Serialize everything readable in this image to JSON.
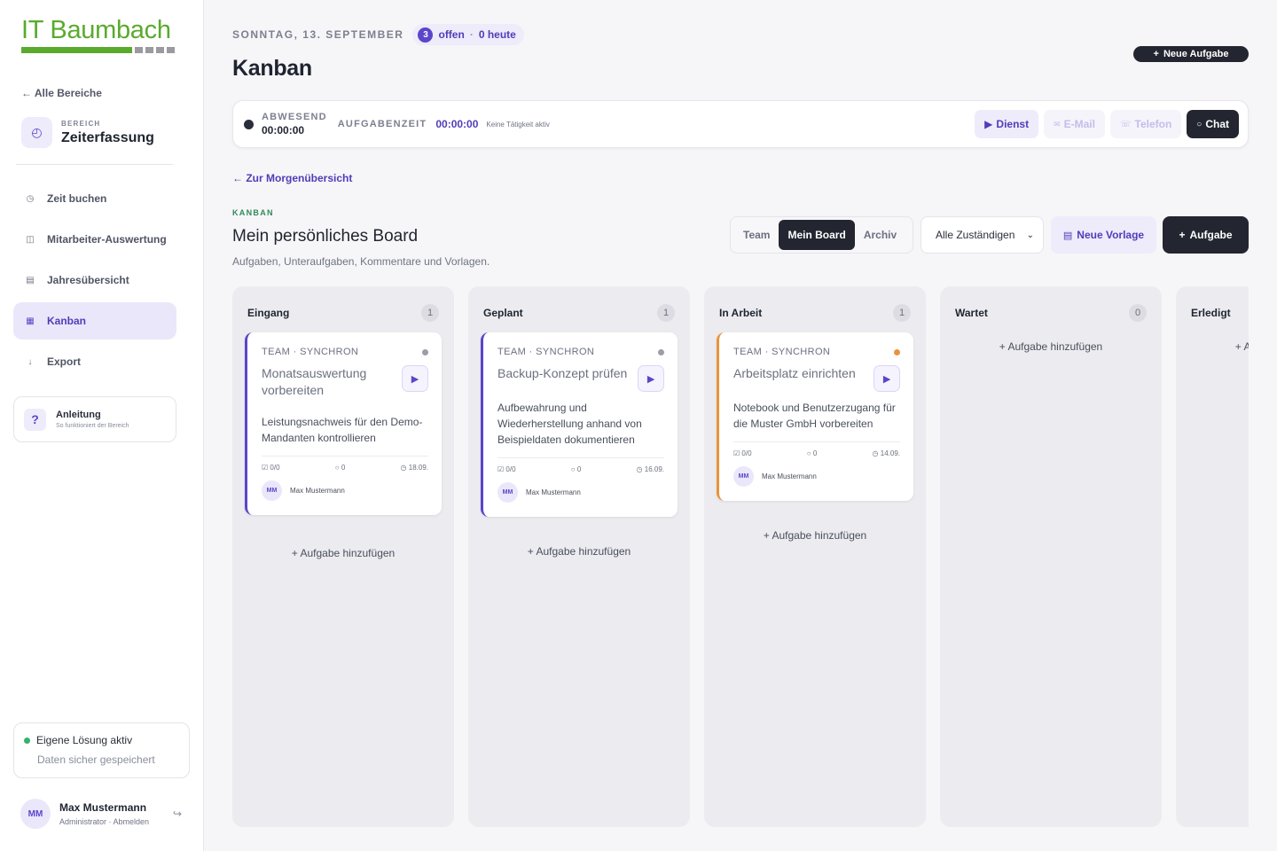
{
  "sidebar": {
    "logo": "IT Baumbach",
    "back_link": "← Alle Bereiche",
    "area_kicker": "BEREICH",
    "area_name": "Zeiterfassung",
    "nav": [
      {
        "label": "Zeit buchen",
        "icon": "clock-icon",
        "glyph": "◷"
      },
      {
        "label": "Mitarbeiter-Auswertung",
        "icon": "columns-icon",
        "glyph": "◫"
      },
      {
        "label": "Jahresübersicht",
        "icon": "calendar-icon",
        "glyph": "▤"
      },
      {
        "label": "Kanban",
        "icon": "kanban-icon",
        "glyph": "▦"
      },
      {
        "label": "Export",
        "icon": "download-icon",
        "glyph": "↓"
      }
    ],
    "help_title": "Anleitung",
    "help_sub": "So funktioniert der Bereich",
    "status_title": "Eigene Lösung aktiv",
    "status_sub": "Daten sicher gespeichert",
    "user_initials": "MM",
    "user_name": "Max Mustermann",
    "user_role": "Administrator · Abmelden"
  },
  "header": {
    "date": "SONNTAG, 13. SEPTEMBER",
    "open_count": "3",
    "open_label": "offen",
    "today_label": "0 heute",
    "title": "Kanban",
    "new_task": "Neue Aufgabe"
  },
  "timebar": {
    "state_label": "ABWESEND",
    "state_time": "00:00:00",
    "task_label": "AUFGABENZEIT",
    "task_time": "00:00:00",
    "note": "Keine Tätigkeit aktiv",
    "btn_dienst": "Dienst",
    "btn_email": "E-Mail",
    "btn_phone": "Telefon",
    "btn_chat": "Chat"
  },
  "morning_link": "← Zur Morgenübersicht",
  "board": {
    "kicker": "KANBAN",
    "title": "Mein persönliches Board",
    "subtitle": "Aufgaben, Unteraufgaben, Kommentare und Vorlagen.",
    "seg": [
      "Team",
      "Mein Board",
      "Archiv"
    ],
    "assignee_select": "Alle Zuständigen",
    "new_template": "Neue Vorlage",
    "add_task": "Aufgabe",
    "add_link": "Aufgabe hinzufügen",
    "columns": [
      {
        "title": "Eingang",
        "count": "1"
      },
      {
        "title": "Geplant",
        "count": "1"
      },
      {
        "title": "In Arbeit",
        "count": "1"
      },
      {
        "title": "Wartet",
        "count": "0"
      },
      {
        "title": "Erledigt",
        "count": ""
      }
    ],
    "cards": [
      {
        "team": "TEAM · SYNCHRON",
        "title": "Monatsauswertung vorbereiten",
        "desc": "Leistungsnachweis für den Demo-Mandanten kontrollieren",
        "subtasks": "0/0",
        "comments": "0",
        "due": "18.09.",
        "assignee_initials": "MM",
        "assignee": "Max Mustermann"
      },
      {
        "team": "TEAM · SYNCHRON",
        "title": "Backup-Konzept prüfen",
        "desc": "Aufbewahrung und Wiederherstellung anhand von Beispieldaten dokumentieren",
        "subtasks": "0/0",
        "comments": "0",
        "due": "16.09.",
        "assignee_initials": "MM",
        "assignee": "Max Mustermann"
      },
      {
        "team": "TEAM · SYNCHRON",
        "title": "Arbeitsplatz einrichten",
        "desc": "Notebook und Benutzerzugang für die Muster GmbH vorbereiten",
        "subtasks": "0/0",
        "comments": "0",
        "due": "14.09.",
        "assignee_initials": "MM",
        "assignee": "Max Mustermann"
      }
    ]
  },
  "colors": {
    "accent": "#5b45c9",
    "brand_green": "#5aaa2e",
    "dark": "#232630",
    "in_progress": "#e9943c"
  }
}
